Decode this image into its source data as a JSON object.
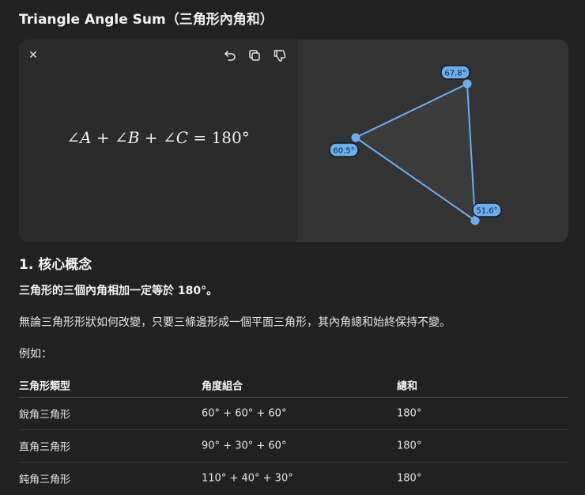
{
  "header": {
    "title": "Triangle Angle Sum（三角形內角和）"
  },
  "card": {
    "close_icon": "close-icon",
    "toolbar": [
      "undo-icon",
      "copy-icon",
      "dislike-icon"
    ],
    "formula": {
      "a": "A",
      "b": "B",
      "c": "C",
      "angle_symbol": "∠",
      "plus": "+",
      "equals": "=",
      "value": "180°"
    },
    "triangle": {
      "stroke_color": "#6aaef0",
      "label_a": "67.8°",
      "label_b": "60.5°",
      "label_c": "51.6°"
    }
  },
  "section": {
    "heading": "1. 核心概念",
    "bold_statement": "三角形的三個內角相加一定等於 180°。",
    "body": "無論三角形形狀如何改變，只要三條邊形成一個平面三角形，其內角總和始終保持不變。",
    "example_label": "例如："
  },
  "table": {
    "headers": [
      "三角形類型",
      "角度組合",
      "總和"
    ],
    "rows": [
      [
        "銳角三角形",
        "60° + 60° + 60°",
        "180°"
      ],
      [
        "直角三角形",
        "90° + 30° + 60°",
        "180°"
      ],
      [
        "鈍角三角形",
        "110° + 40° + 30°",
        "180°"
      ]
    ]
  }
}
